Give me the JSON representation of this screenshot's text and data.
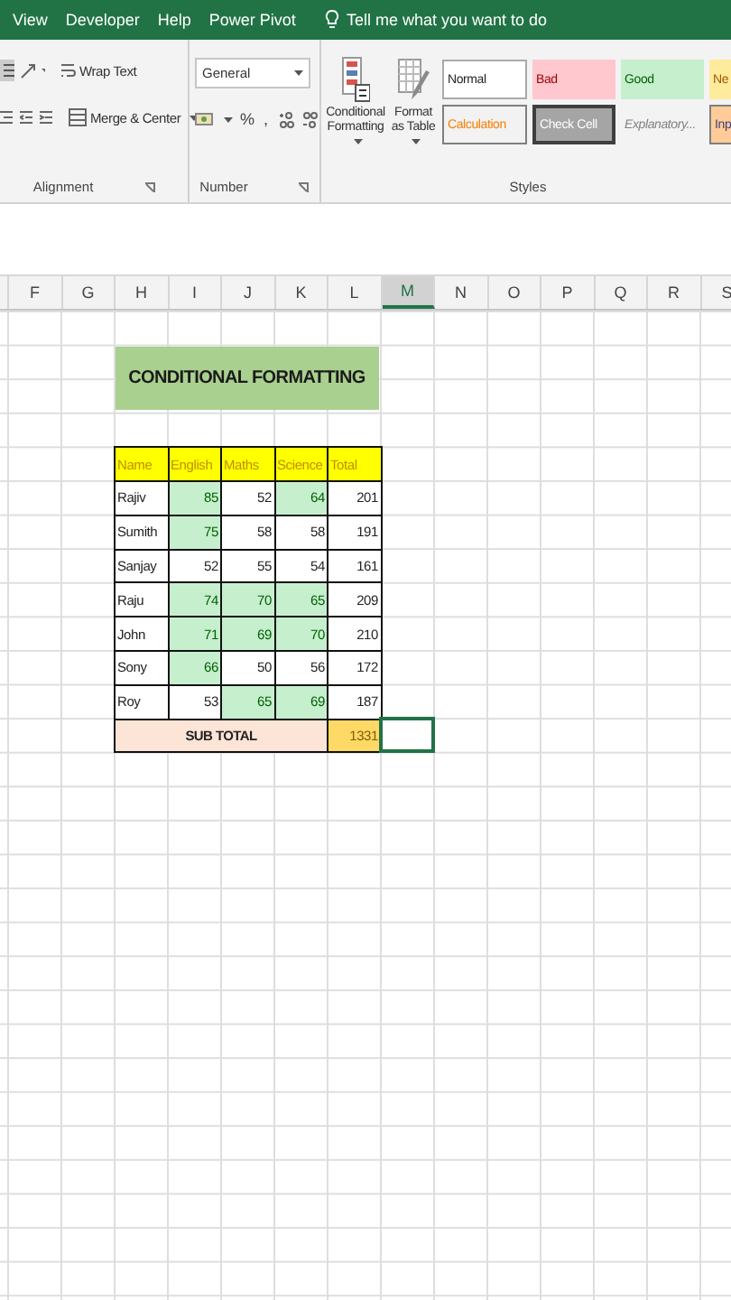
{
  "tabs": [
    {
      "label": "View"
    },
    {
      "label": "Developer"
    },
    {
      "label": "Help"
    },
    {
      "label": "Power Pivot"
    }
  ],
  "tell_me": "Tell me what you want to do",
  "ribbon": {
    "alignment": {
      "label": "Alignment",
      "wrap_text": "Wrap Text",
      "merge_center": "Merge & Center"
    },
    "number": {
      "label": "Number",
      "format": "General",
      "percent": "%",
      "comma": ","
    },
    "styles": {
      "label": "Styles",
      "conditional_formatting": "Conditional Formatting",
      "format_as_table": "Format as Table",
      "cell_styles": [
        {
          "label": "Normal",
          "kind": "normal"
        },
        {
          "label": "Bad",
          "kind": "bad"
        },
        {
          "label": "Good",
          "kind": "good"
        },
        {
          "label": "Ne",
          "kind": "neutral"
        },
        {
          "label": "Calculation",
          "kind": "calculation"
        },
        {
          "label": "Check Cell",
          "kind": "check"
        },
        {
          "label": "Explanatory...",
          "kind": "explanatory"
        },
        {
          "label": "Inp",
          "kind": "input"
        }
      ]
    }
  },
  "columns": [
    {
      "label": "F",
      "selected": false
    },
    {
      "label": "G",
      "selected": false
    },
    {
      "label": "H",
      "selected": false
    },
    {
      "label": "I",
      "selected": false
    },
    {
      "label": "J",
      "selected": false
    },
    {
      "label": "K",
      "selected": false
    },
    {
      "label": "L",
      "selected": false
    },
    {
      "label": "M",
      "selected": true
    },
    {
      "label": "N",
      "selected": false
    },
    {
      "label": "O",
      "selected": false
    },
    {
      "label": "P",
      "selected": false
    },
    {
      "label": "Q",
      "selected": false
    },
    {
      "label": "R",
      "selected": false
    },
    {
      "label": "S",
      "selected": false
    }
  ],
  "title": "CONDITIONAL FORMATTING",
  "table": {
    "columns": [
      "Name",
      "English",
      "Maths",
      "Science",
      "Total"
    ],
    "rows": [
      {
        "name": "Rajiv",
        "scores": [
          {
            "value": "85",
            "highlight": true
          },
          {
            "value": "52",
            "highlight": false
          },
          {
            "value": "64",
            "highlight": true
          }
        ],
        "total": "201"
      },
      {
        "name": "Sumith",
        "scores": [
          {
            "value": "75",
            "highlight": true
          },
          {
            "value": "58",
            "highlight": false
          },
          {
            "value": "58",
            "highlight": false
          }
        ],
        "total": "191"
      },
      {
        "name": "Sanjay",
        "scores": [
          {
            "value": "52",
            "highlight": false
          },
          {
            "value": "55",
            "highlight": false
          },
          {
            "value": "54",
            "highlight": false
          }
        ],
        "total": "161"
      },
      {
        "name": "Raju",
        "scores": [
          {
            "value": "74",
            "highlight": true
          },
          {
            "value": "70",
            "highlight": true
          },
          {
            "value": "65",
            "highlight": true
          }
        ],
        "total": "209"
      },
      {
        "name": "John",
        "scores": [
          {
            "value": "71",
            "highlight": true
          },
          {
            "value": "69",
            "highlight": true
          },
          {
            "value": "70",
            "highlight": true
          }
        ],
        "total": "210"
      },
      {
        "name": "Sony",
        "scores": [
          {
            "value": "66",
            "highlight": true
          },
          {
            "value": "50",
            "highlight": false
          },
          {
            "value": "56",
            "highlight": false
          }
        ],
        "total": "172"
      },
      {
        "name": "Roy",
        "scores": [
          {
            "value": "53",
            "highlight": false
          },
          {
            "value": "65",
            "highlight": true
          },
          {
            "value": "69",
            "highlight": true
          }
        ],
        "total": "187"
      }
    ],
    "subtotal": {
      "label": "SUB TOTAL",
      "value": "1331"
    }
  }
}
